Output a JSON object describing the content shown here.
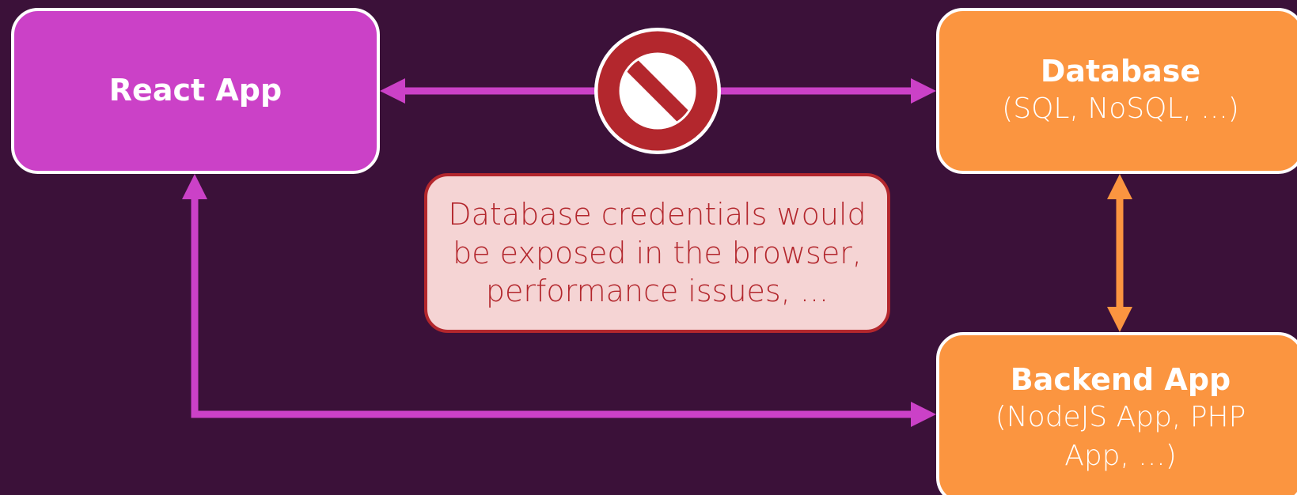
{
  "react_app": {
    "title": "React App"
  },
  "database": {
    "title": "Database",
    "subtitle": "(SQL, NoSQL, ...)"
  },
  "backend_app": {
    "title": "Backend App",
    "subtitle": "(NodeJS App, PHP App, ...)"
  },
  "warning": {
    "text": "Database credentials would be exposed in the browser, performance issues, ..."
  },
  "prohibited_icon": "no-entry-icon",
  "colors": {
    "background": "#3b1139",
    "react_box": "#cb41c7",
    "backend_boxes": "#fb9540",
    "border": "#ffffff",
    "warning_fill": "#f5d4d4",
    "warning_accent": "#b3272d"
  }
}
